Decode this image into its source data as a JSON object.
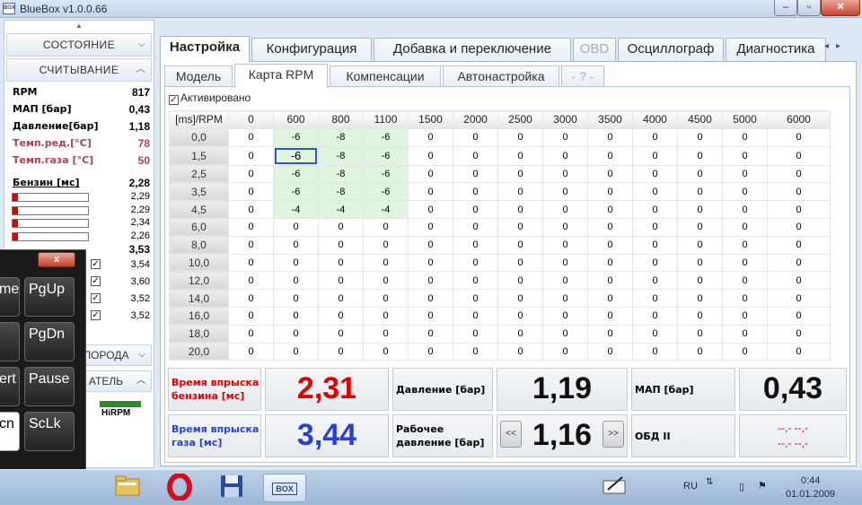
{
  "window": {
    "title": "BlueBox v1.0.0.66",
    "app_icon_text": "BOX"
  },
  "sidebar": {
    "state_label": "СОСТОЯНИЕ",
    "read_label": "СЧИТЫВАНИЕ",
    "rows": [
      {
        "label": "RPM",
        "value": "817",
        "red": false
      },
      {
        "label": "МАП [бар]",
        "value": "0,43",
        "red": false
      },
      {
        "label": "Давление[бар]",
        "value": "1,18",
        "red": false
      },
      {
        "label": "Темп.ред.[°C]",
        "value": "78",
        "red": true
      },
      {
        "label": "Темп.газа [°C]",
        "value": "50",
        "red": true
      }
    ],
    "petrol_label": "Бензин [мс]",
    "petrol_value": "2,28",
    "petrol_bars": [
      "2,29",
      "2,29",
      "2,34",
      "2,26"
    ],
    "gas_value": "3,53",
    "gas_bars": [
      "3,54",
      "3,60",
      "3,52",
      "3,52"
    ],
    "bottom_header_1": "ПОРОДА",
    "bottom_header_2": "АТЕЛЬ",
    "hirpm_label": "HiRPM"
  },
  "tabs_main": [
    {
      "label": "Настройка",
      "active": true,
      "disabled": false
    },
    {
      "label": "Конфигурация",
      "active": false,
      "disabled": false
    },
    {
      "label": "Добавка и переключение",
      "active": false,
      "disabled": false
    },
    {
      "label": "OBD",
      "active": false,
      "disabled": true
    },
    {
      "label": "Осциллограф",
      "active": false,
      "disabled": false
    },
    {
      "label": "Диагностика",
      "active": false,
      "disabled": false
    }
  ],
  "tabs_sub": [
    {
      "label": "Модель",
      "active": false,
      "disabled": false
    },
    {
      "label": "Карта RPM",
      "active": true,
      "disabled": false
    },
    {
      "label": "Компенсации",
      "active": false,
      "disabled": false
    },
    {
      "label": "Автонастройка",
      "active": false,
      "disabled": false
    },
    {
      "label": "- ? -",
      "active": false,
      "disabled": true
    }
  ],
  "activated_label": "Активировано",
  "grid": {
    "corner": "[ms]/RPM",
    "columns": [
      "0",
      "600",
      "800",
      "1100",
      "1500",
      "2000",
      "2500",
      "3000",
      "3500",
      "4000",
      "4500",
      "5000",
      "6000"
    ],
    "rows": [
      {
        "label": "0,0",
        "values": [
          "0",
          "-6",
          "-8",
          "-6",
          "0",
          "0",
          "0",
          "0",
          "0",
          "0",
          "0",
          "0",
          "0"
        ]
      },
      {
        "label": "1,5",
        "values": [
          "0",
          "-6",
          "-8",
          "-6",
          "0",
          "0",
          "0",
          "0",
          "0",
          "0",
          "0",
          "0",
          "0"
        ]
      },
      {
        "label": "2,5",
        "values": [
          "0",
          "-6",
          "-8",
          "-6",
          "0",
          "0",
          "0",
          "0",
          "0",
          "0",
          "0",
          "0",
          "0"
        ]
      },
      {
        "label": "3,5",
        "values": [
          "0",
          "-6",
          "-8",
          "-6",
          "0",
          "0",
          "0",
          "0",
          "0",
          "0",
          "0",
          "0",
          "0"
        ]
      },
      {
        "label": "4,5",
        "values": [
          "0",
          "-4",
          "-4",
          "-4",
          "0",
          "0",
          "0",
          "0",
          "0",
          "0",
          "0",
          "0",
          "0"
        ]
      },
      {
        "label": "6,0",
        "values": [
          "0",
          "0",
          "0",
          "0",
          "0",
          "0",
          "0",
          "0",
          "0",
          "0",
          "0",
          "0",
          "0"
        ]
      },
      {
        "label": "8,0",
        "values": [
          "0",
          "0",
          "0",
          "0",
          "0",
          "0",
          "0",
          "0",
          "0",
          "0",
          "0",
          "0",
          "0"
        ]
      },
      {
        "label": "10,0",
        "values": [
          "0",
          "0",
          "0",
          "0",
          "0",
          "0",
          "0",
          "0",
          "0",
          "0",
          "0",
          "0",
          "0"
        ]
      },
      {
        "label": "12,0",
        "values": [
          "0",
          "0",
          "0",
          "0",
          "0",
          "0",
          "0",
          "0",
          "0",
          "0",
          "0",
          "0",
          "0"
        ]
      },
      {
        "label": "14,0",
        "values": [
          "0",
          "0",
          "0",
          "0",
          "0",
          "0",
          "0",
          "0",
          "0",
          "0",
          "0",
          "0",
          "0"
        ]
      },
      {
        "label": "16,0",
        "values": [
          "0",
          "0",
          "0",
          "0",
          "0",
          "0",
          "0",
          "0",
          "0",
          "0",
          "0",
          "0",
          "0"
        ]
      },
      {
        "label": "18,0",
        "values": [
          "0",
          "0",
          "0",
          "0",
          "0",
          "0",
          "0",
          "0",
          "0",
          "0",
          "0",
          "0",
          "0"
        ]
      },
      {
        "label": "20,0",
        "values": [
          "0",
          "0",
          "0",
          "0",
          "0",
          "0",
          "0",
          "0",
          "0",
          "0",
          "0",
          "0",
          "0"
        ]
      }
    ],
    "selected_cell": {
      "row": 1,
      "col": 1
    }
  },
  "readouts": {
    "petrol_inj_label_1": "Время впрыска",
    "petrol_inj_label_2": "бензина [мс]",
    "petrol_inj_value": "2,31",
    "gas_inj_label_1": "Время впрыска",
    "gas_inj_label_2": "газа [мс]",
    "gas_inj_value": "3,44",
    "pressure_label": "Давление [бар]",
    "pressure_value": "1,19",
    "work_pressure_label_1": "Рабочее",
    "work_pressure_label_2": "давление [бар]",
    "work_pressure_value": "1,16",
    "dec_btn": "<<",
    "inc_btn": ">>",
    "map_label": "МАП [бар]",
    "map_value": "0,43",
    "obd_label": "ОБД II",
    "obd_value_1": "--,- --,-",
    "obd_value_2": "--,- --,-"
  },
  "osk": {
    "close": "x",
    "keys": [
      "me",
      "PgUp",
      "",
      "PgDn",
      "ert",
      "Pause",
      "cn",
      "ScLk"
    ]
  },
  "taskbar": {
    "lang": "RU",
    "time": "0:44",
    "date": "01.01.2009",
    "bluebox_label": "BOX"
  },
  "colors": {
    "red_value": "#e00000",
    "blue_value": "#2a40d0",
    "selection": "#2a5ac0",
    "highlight": "#e0f5df"
  }
}
